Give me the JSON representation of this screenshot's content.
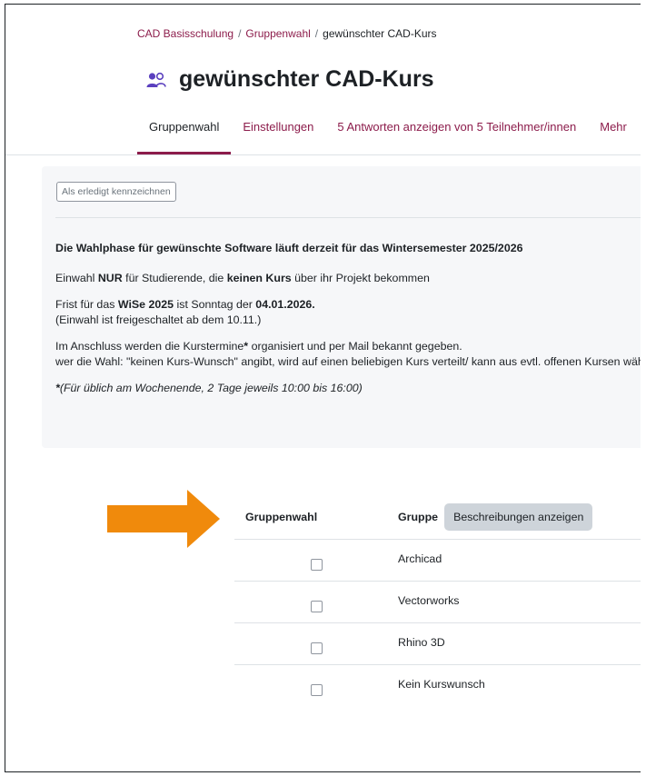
{
  "breadcrumb": {
    "items": [
      "CAD Basisschulung",
      "Gruppenwahl",
      "gewünschter CAD-Kurs"
    ],
    "separator": "/"
  },
  "page": {
    "title": "gewünschter CAD-Kurs",
    "icon": "users-icon"
  },
  "tabs": [
    {
      "label": "Gruppenwahl",
      "active": true
    },
    {
      "label": "Einstellungen"
    },
    {
      "label": "5 Antworten anzeigen von 5 Teilnehmer/innen"
    },
    {
      "label": "Mehr"
    }
  ],
  "completion_button": "Als erledigt kennzeichnen",
  "intro": {
    "heading": "Die Wahlphase für gewünschte Software läuft derzeit für das Wintersemester 2025/2026",
    "p1": {
      "a": "Einwahl ",
      "b": "NUR",
      "c": " für Studierende, die ",
      "d": "keinen Kurs",
      "e": " über ihr Projekt bekommen"
    },
    "p2": {
      "a": "Frist für das ",
      "b": "WiSe 2025",
      "c": " ist Sonntag der ",
      "d": "04.01.2026.",
      "line2": "(Einwahl ist freigeschaltet ab dem 10.11.)"
    },
    "p3": {
      "a": "Im Anschluss werden die Kurstermine",
      "b": "*",
      "c": " organisiert und per Mail bekannt gegeben.",
      "line2": "wer die Wahl: \"keinen Kurs-Wunsch\" angibt, wird auf einen beliebigen Kurs verteilt/ kann aus evtl. offenen Kursen wählen"
    },
    "p4": {
      "a": "*",
      "b": "(Für üblich am Wochenende, 2 Tage jeweils 10:00 bis 16:00)"
    }
  },
  "table": {
    "col_choice": "Gruppenwahl",
    "col_group": "Gruppe",
    "desc_button": "Beschreibungen anzeigen",
    "rows": [
      {
        "name": "Archicad",
        "checked": false
      },
      {
        "name": "Vectorworks",
        "checked": false
      },
      {
        "name": "Rhino 3D",
        "checked": false
      },
      {
        "name": "Kein Kurswunsch",
        "checked": false
      }
    ]
  },
  "colors": {
    "accent": "#8c1c4b",
    "arrow": "#f08a0c",
    "panel_bg": "#f6f7f9"
  }
}
